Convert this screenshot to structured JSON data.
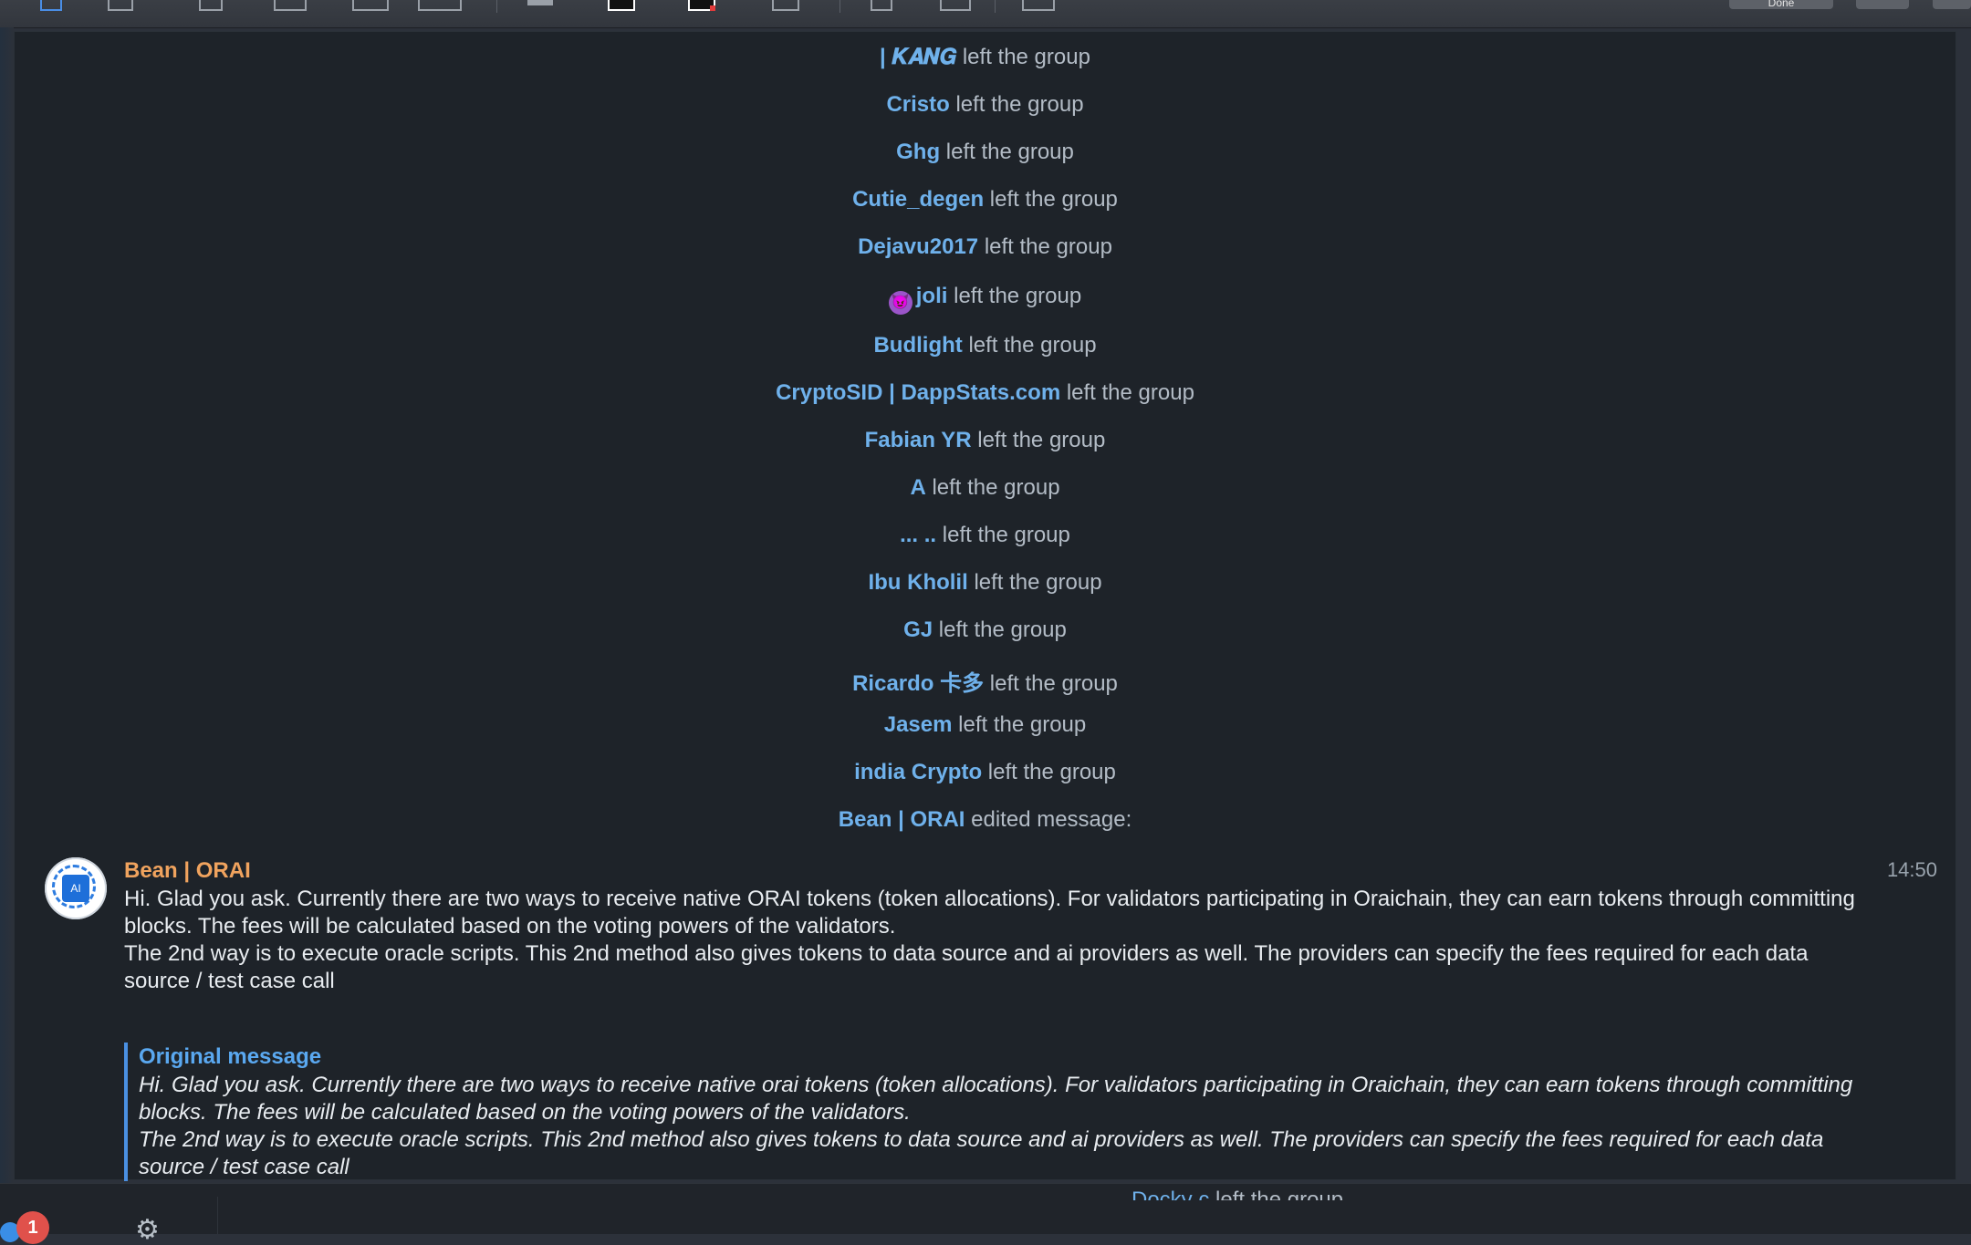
{
  "service_messages": [
    {
      "name": "| 𝑲𝑨𝑵𝑮",
      "action": "left the group"
    },
    {
      "name": "Cristo",
      "action": "left the group"
    },
    {
      "name": "Ghg",
      "action": "left the group"
    },
    {
      "name": "Cutie_degen",
      "action": "left the group"
    },
    {
      "name": "Dejavu2017",
      "action": "left the group"
    },
    {
      "name": "joli",
      "action": "left the group",
      "emoji": "😈"
    },
    {
      "name": "Budlight",
      "action": "left the group"
    },
    {
      "name": "CryptoSID | DappStats.com",
      "action": "left the group"
    },
    {
      "name": "Fabian YR",
      "action": "left the group"
    },
    {
      "name": "A",
      "action": "left the group"
    },
    {
      "name": "... ..",
      "action": "left the group"
    },
    {
      "name": "Ibu Kholil",
      "action": "left the group"
    },
    {
      "name": "GJ",
      "action": "left the group"
    },
    {
      "name": "Ricardo 卡多",
      "action": "left the group"
    },
    {
      "name": "Jasem",
      "action": "left the group"
    },
    {
      "name": "india Crypto",
      "action": "left the group"
    },
    {
      "name": "Bean | ORAI",
      "action": "edited message:"
    }
  ],
  "message": {
    "sender": "Bean | ORAI",
    "time": "14:50",
    "avatar_label": "AI",
    "text_line1": "Hi. Glad you ask. Currently there are two ways to receive native ORAI tokens (token allocations). For validators participating in Oraichain, they can earn tokens through committing blocks. The fees will be calculated based on the voting powers of the validators.",
    "text_line2": "The 2nd way is to execute oracle scripts. This 2nd method also gives tokens to data source and ai providers as well. The providers can specify the fees required for each data source / test case call",
    "quote_title": "Original message",
    "quote_line1": "Hi. Glad you ask. Currently there are two ways to receive native orai tokens (token allocations). For validators participating in Oraichain, they can earn tokens through committing blocks. The fees will be calculated based on the voting powers of the validators.",
    "quote_line2": "The 2nd way is to execute oracle scripts. This 2nd method also gives tokens to data source and ai providers as well. The providers can specify the fees required for each data source / test case call"
  },
  "bottom": {
    "peek_name": "Docky c",
    "peek_action": "left the group",
    "badge_count": "1"
  },
  "toolbar": {
    "done_label": "Done"
  },
  "colors": {
    "accent_name": "#6fb1eb",
    "sender_name": "#f0a35e",
    "quote_bar": "#4a90e2",
    "background": "#1e2329"
  },
  "icons": [
    "selection-icon",
    "sketch-icon",
    "draw-icon",
    "shapes-icon",
    "text-icon",
    "sign-icon",
    "line-style-icon",
    "border-color-icon",
    "fill-color-icon",
    "font-icon",
    "rotate-icon",
    "annotate-icon",
    "share-icon",
    "settings-gear-icon"
  ]
}
